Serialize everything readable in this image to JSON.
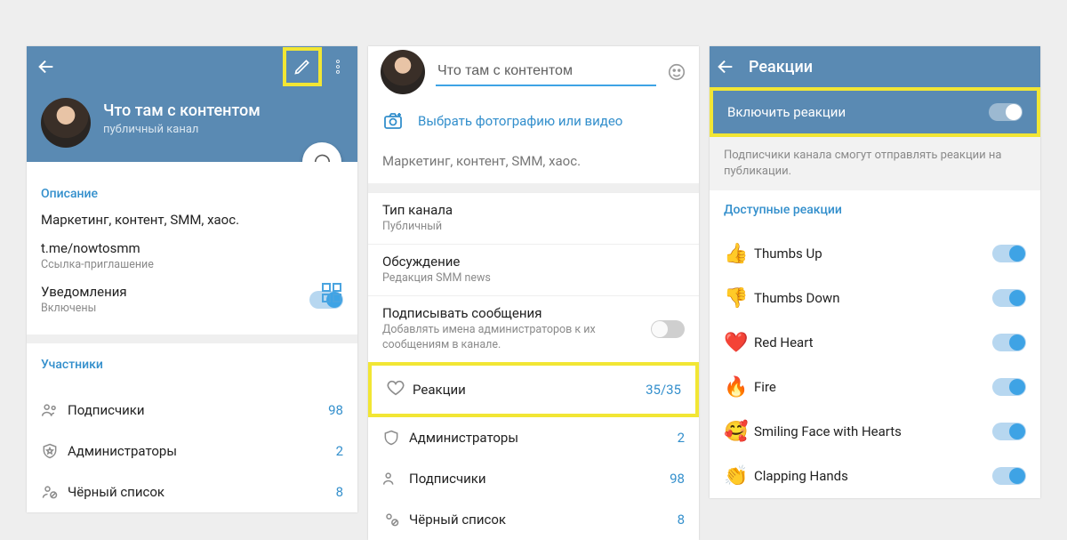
{
  "pane1": {
    "title": "Что там с контентом",
    "subtitle": "публичный канал",
    "section_description_title": "Описание",
    "description": "Маркетинг, контент, SMM, хаос.",
    "link": "t.me/nowtosmm",
    "link_caption": "Ссылка-приглашение",
    "notifications_label": "Уведомления",
    "notifications_value": "Включены",
    "members_title": "Участники",
    "members": [
      {
        "label": "Подписчики",
        "value": "98"
      },
      {
        "label": "Администраторы",
        "value": "2"
      },
      {
        "label": "Чёрный список",
        "value": "8"
      }
    ]
  },
  "pane2": {
    "name_input": "Что там с контентом",
    "pick_media": "Выбрать фотографию или видео",
    "bio": "Маркетинг, контент, SMM, хаос.",
    "settings": [
      {
        "title": "Тип канала",
        "sub": "Публичный"
      },
      {
        "title": "Обсуждение",
        "sub": "Редакция SMM news"
      },
      {
        "title": "Подписывать сообщения",
        "sub": "Добавлять имена администраторов к их сообщениям в канале."
      }
    ],
    "reactions_label": "Реакции",
    "reactions_count": "35/35",
    "admin_rows": [
      {
        "label": "Администраторы",
        "value": "2"
      },
      {
        "label": "Подписчики",
        "value": "98"
      },
      {
        "label": "Чёрный список",
        "value": "8"
      }
    ]
  },
  "pane3": {
    "header": "Реакции",
    "enable_label": "Включить реакции",
    "enable_desc": "Подписчики канала смогут отправлять реакции на публикации.",
    "available_title": "Доступные реакции",
    "reactions": [
      {
        "emoji": "👍",
        "name": "Thumbs Up"
      },
      {
        "emoji": "👎",
        "name": "Thumbs Down"
      },
      {
        "emoji": "❤️",
        "name": "Red Heart"
      },
      {
        "emoji": "🔥",
        "name": "Fire"
      },
      {
        "emoji": "🥰",
        "name": "Smiling Face with Hearts"
      },
      {
        "emoji": "👏",
        "name": "Clapping Hands"
      }
    ]
  }
}
